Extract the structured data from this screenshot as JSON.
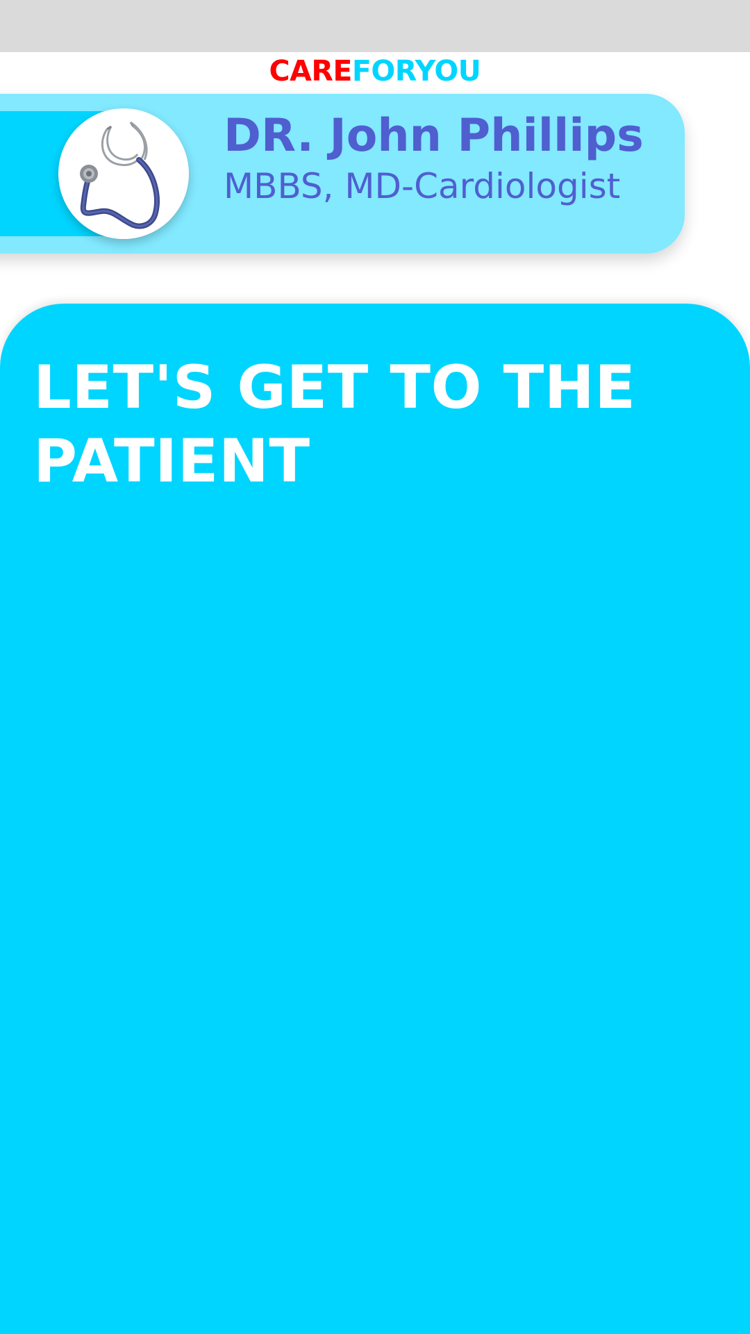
{
  "brand": {
    "part1": "CARE",
    "part2": "FORYOU",
    "part1_color": "#ff0000",
    "part2_color": "#00d5ff"
  },
  "doctor": {
    "name": "DR. John Phillips",
    "degree": "MBBS, MD-Cardiologist",
    "avatar_icon": "stethoscope-icon"
  },
  "main": {
    "headline": "LET'S GET TO THE PATIENT"
  },
  "colors": {
    "primary": "#00d5ff",
    "card": "#82e9ff",
    "text_accent": "#4f5fcf",
    "status_bar": "#dadada"
  }
}
